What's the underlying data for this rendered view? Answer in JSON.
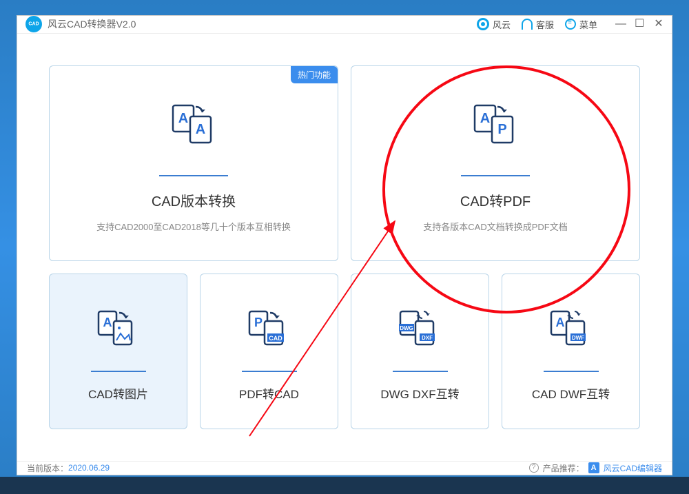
{
  "app": {
    "title": "风云CAD转换器V2.0"
  },
  "titlebar": {
    "brand": "风云",
    "support": "客服",
    "menu": "菜单"
  },
  "cards": {
    "hot_badge": "热门功能",
    "cad_version": {
      "title": "CAD版本转换",
      "desc": "支持CAD2000至CAD2018等几十个版本互相转换"
    },
    "cad_pdf": {
      "title": "CAD转PDF",
      "desc": "支持各版本CAD文档转换成PDF文档"
    },
    "cad_img": {
      "title": "CAD转图片"
    },
    "pdf_cad": {
      "title": "PDF转CAD"
    },
    "dwg_dxf": {
      "title": "DWG DXF互转"
    },
    "cad_dwf": {
      "title": "CAD DWF互转"
    }
  },
  "footer": {
    "version_label": "当前版本：",
    "version": "2020.06.29",
    "promo_label": "产品推荐：",
    "promo_product": "风云CAD编辑器"
  }
}
